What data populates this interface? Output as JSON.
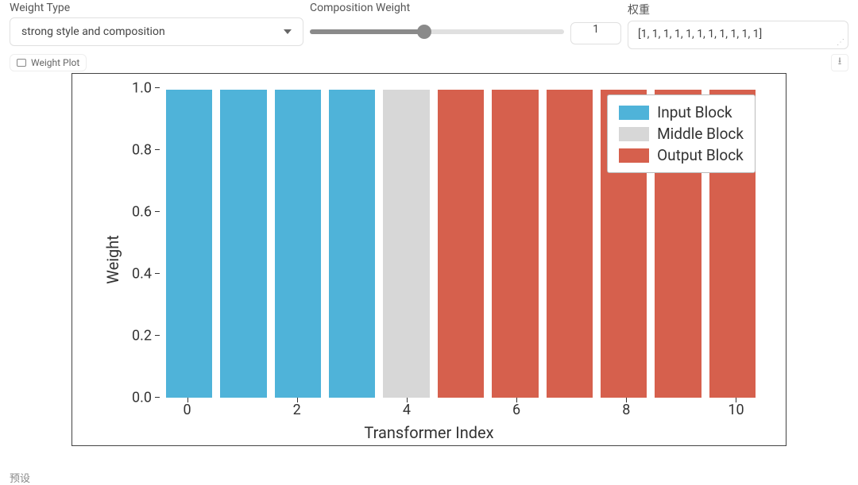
{
  "controls": {
    "weight_type": {
      "label": "Weight Type",
      "value": "strong style and composition"
    },
    "composition_weight": {
      "label": "Composition Weight",
      "number_value": "1",
      "slider_fraction": 0.45
    },
    "weights": {
      "label": "权重",
      "value": "[1, 1, 1, 1, 1, 1, 1, 1, 1, 1, 1]"
    }
  },
  "plot_tab_label": "Weight Plot",
  "bottom_label": "预设",
  "chart_data": {
    "type": "bar",
    "categories": [
      0,
      1,
      2,
      3,
      4,
      5,
      6,
      7,
      8,
      9,
      10
    ],
    "values": [
      1.0,
      1.0,
      1.0,
      1.0,
      1.0,
      1.0,
      1.0,
      1.0,
      1.0,
      1.0,
      1.0
    ],
    "groups": [
      "Input Block",
      "Input Block",
      "Input Block",
      "Input Block",
      "Middle Block",
      "Output Block",
      "Output Block",
      "Output Block",
      "Output Block",
      "Output Block",
      "Output Block"
    ],
    "xlabel": "Transformer Index",
    "ylabel": "Weight",
    "ylim": [
      0.0,
      1.0
    ],
    "yticks": [
      0.0,
      0.2,
      0.4,
      0.6,
      0.8,
      1.0
    ],
    "xticks": [
      0,
      2,
      4,
      6,
      8,
      10
    ],
    "legend": {
      "entries": [
        {
          "name": "Input Block",
          "color": "#4fb3d9"
        },
        {
          "name": "Middle Block",
          "color": "#d7d7d7"
        },
        {
          "name": "Output Block",
          "color": "#d6604d"
        }
      ],
      "position": "upper right"
    }
  }
}
